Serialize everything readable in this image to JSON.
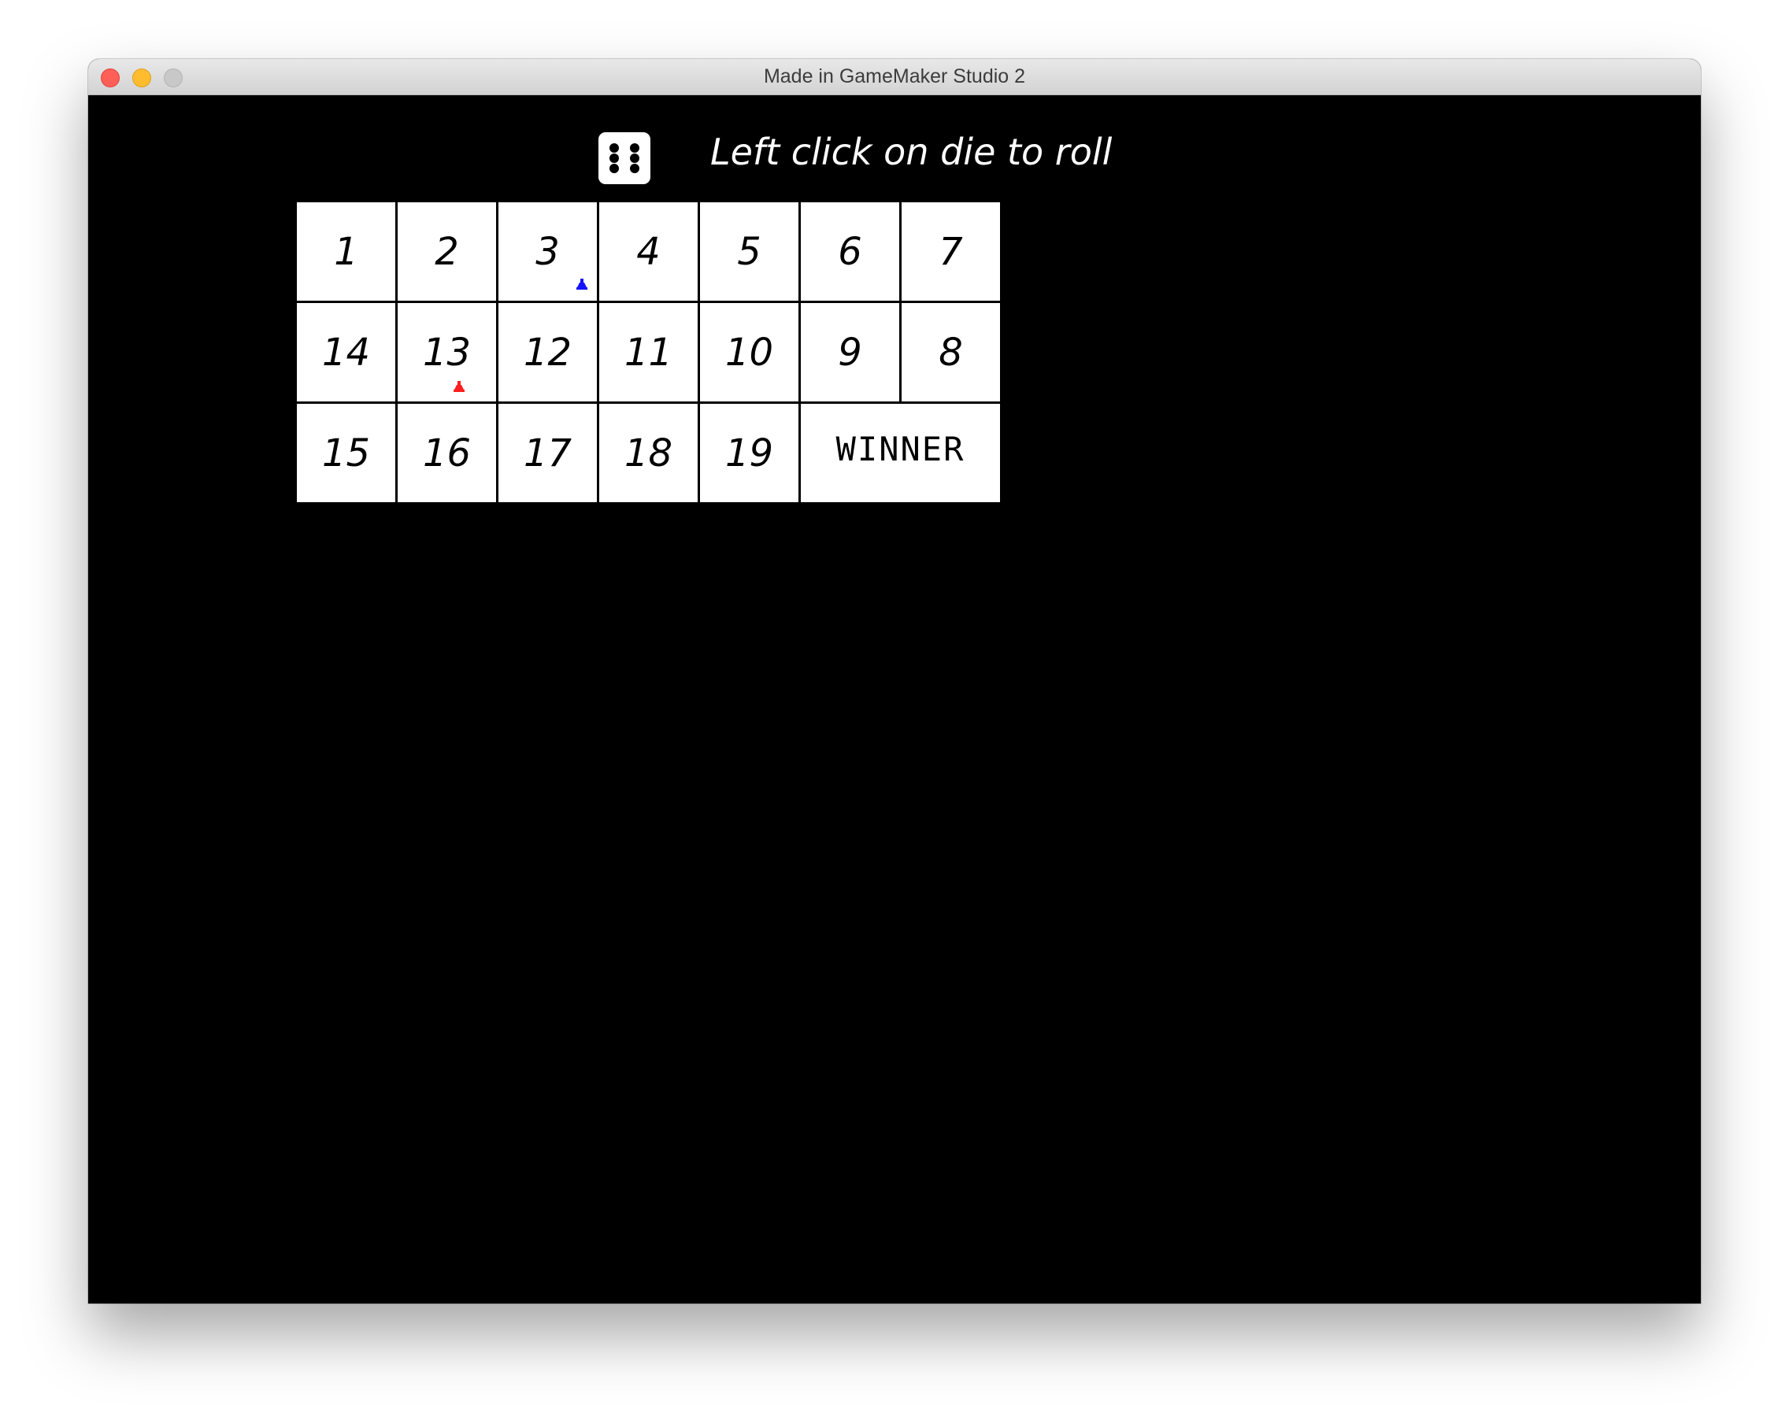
{
  "window": {
    "title": "Made in GameMaker Studio 2"
  },
  "game": {
    "instruction": "Left click on die to roll",
    "die_value": 6,
    "cells": [
      {
        "label": "1"
      },
      {
        "label": "2"
      },
      {
        "label": "3"
      },
      {
        "label": "4"
      },
      {
        "label": "5"
      },
      {
        "label": "6"
      },
      {
        "label": "7"
      },
      {
        "label": "14"
      },
      {
        "label": "13"
      },
      {
        "label": "12"
      },
      {
        "label": "11"
      },
      {
        "label": "10"
      },
      {
        "label": "9"
      },
      {
        "label": "8"
      },
      {
        "label": "15"
      },
      {
        "label": "16"
      },
      {
        "label": "17"
      },
      {
        "label": "18"
      },
      {
        "label": "19"
      },
      {
        "label": "WINNER"
      }
    ],
    "tokens": [
      {
        "name": "blue-player-token",
        "color": "#1414ff",
        "square": "3"
      },
      {
        "name": "red-player-token",
        "color": "#ff1e1e",
        "square": "13"
      }
    ]
  },
  "colors": {
    "background": "#000000",
    "cell": "#ffffff",
    "text_on_dark": "#ffffff",
    "text_on_cell": "#000000"
  }
}
